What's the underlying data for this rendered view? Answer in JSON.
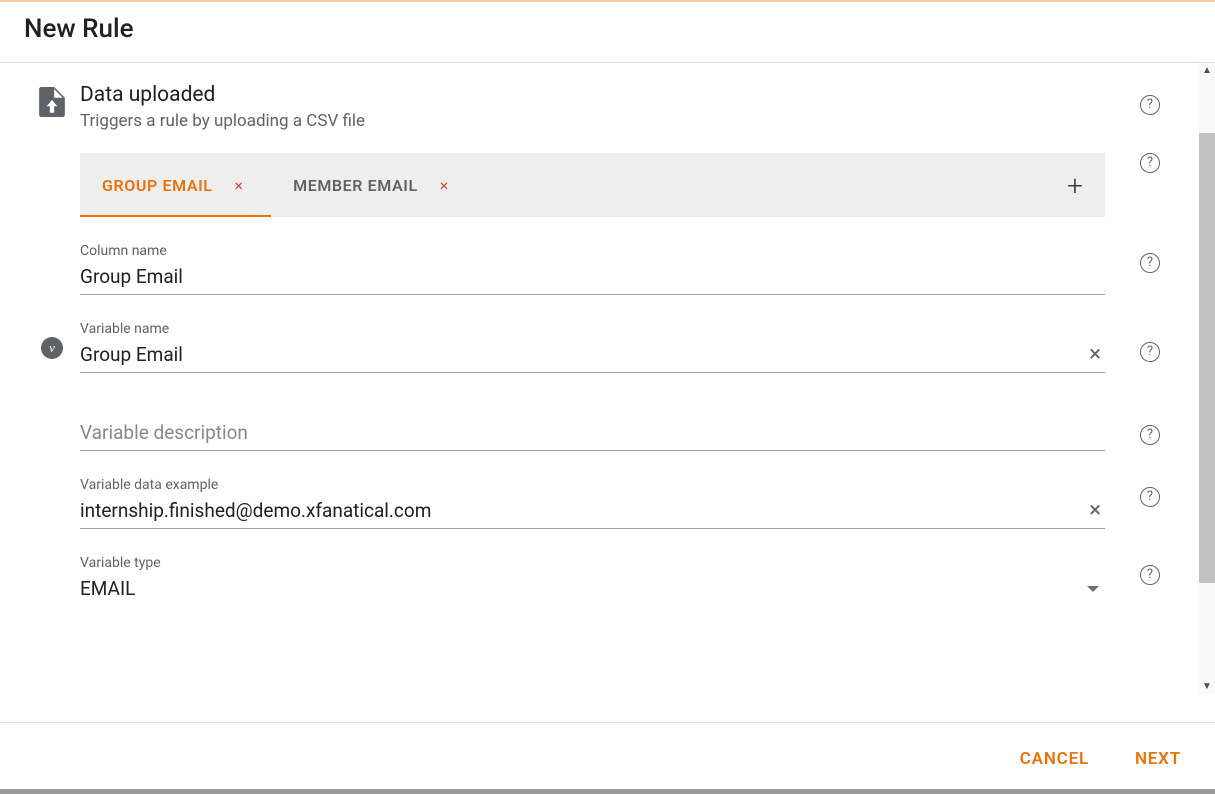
{
  "header": {
    "title": "New Rule"
  },
  "trigger": {
    "title": "Data uploaded",
    "subtitle": "Triggers a rule by uploading a CSV file"
  },
  "tabs": {
    "items": [
      {
        "label": "GROUP EMAIL",
        "active": true
      },
      {
        "label": "MEMBER EMAIL",
        "active": false
      }
    ],
    "add_icon": "+"
  },
  "fields": {
    "column_name": {
      "label": "Column name",
      "value": "Group Email"
    },
    "variable_name": {
      "label": "Variable name",
      "value": "Group Email"
    },
    "variable_description": {
      "placeholder": "Variable description",
      "value": ""
    },
    "variable_example": {
      "label": "Variable data example",
      "value": "internship.finished@demo.xfanatical.com"
    },
    "variable_type": {
      "label": "Variable type",
      "value": "EMAIL"
    }
  },
  "footer": {
    "cancel": "CANCEL",
    "next": "NEXT"
  },
  "icons": {
    "close_x": "×",
    "help": "?",
    "nu": "ν",
    "scroll_up": "▲",
    "scroll_down": "▼"
  }
}
